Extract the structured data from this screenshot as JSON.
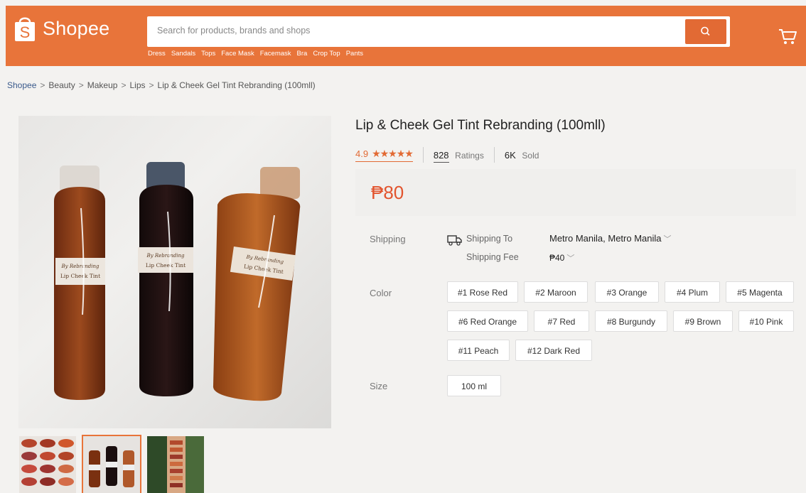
{
  "header": {
    "logo_text": "Shopee",
    "search_placeholder": "Search for products, brands and shops",
    "search_hints": [
      "Dress",
      "Sandals",
      "Tops",
      "Face Mask",
      "Facemask",
      "Bra",
      "Crop Top",
      "Pants"
    ],
    "accent_color": "#e8743a"
  },
  "breadcrumb": [
    "Shopee",
    "Beauty",
    "Makeup",
    "Lips",
    "Lip & Cheek Gel Tint Rebranding (100mll)"
  ],
  "product": {
    "title": "Lip & Cheek Gel Tint Rebranding (100mll)",
    "rating": "4.9",
    "stars": "★★★★★",
    "ratings_count": "828",
    "ratings_label": "Ratings",
    "sold_count": "6K",
    "sold_label": "Sold",
    "price": "₱80"
  },
  "shipping": {
    "label": "Shipping",
    "to_label": "Shipping To",
    "to_value": "Metro Manila, Metro Manila",
    "fee_label": "Shipping Fee",
    "fee_value": "₱40"
  },
  "color": {
    "label": "Color",
    "options": [
      "#1 Rose Red",
      "#2 Maroon",
      "#3 Orange",
      "#4 Plum",
      "#5 Magenta",
      "#6 Red Orange",
      "#7 Red",
      "#8 Burgundy",
      "#9 Brown",
      "#10 Pink",
      "#11 Peach",
      "#12 Dark Red"
    ]
  },
  "size": {
    "label": "Size",
    "options": [
      "100 ml"
    ]
  },
  "gallery": {
    "main_image_labels": [
      "By Rebranding",
      "Lip Cheek Tint"
    ],
    "thumbnail_count": "3"
  }
}
